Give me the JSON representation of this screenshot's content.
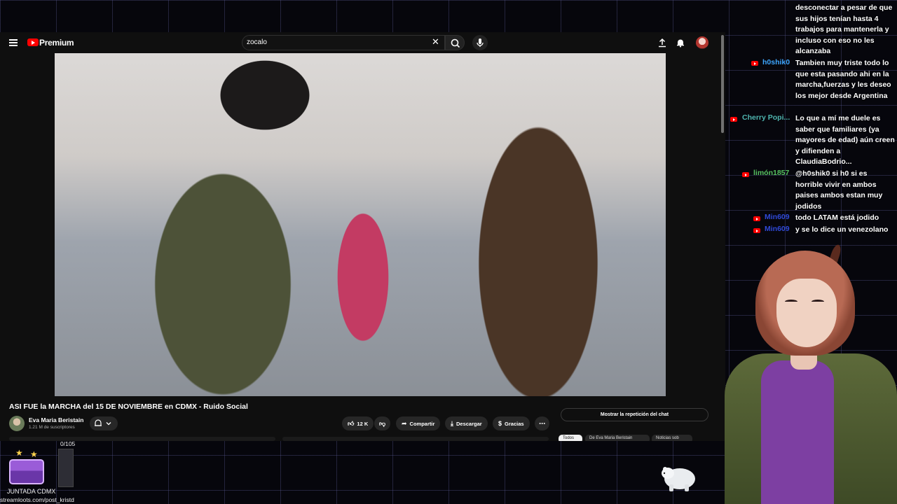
{
  "youtube": {
    "brand": "Premium",
    "search": {
      "value": "zocalo",
      "placeholder": ""
    },
    "video": {
      "title": "ASI FUE la MARCHA del 15 DE NOVIEMBRE en CDMX - Ruido Social",
      "channel_name": "Eva Maria Beristain",
      "subscribers": "1.21 M de suscriptores",
      "likes": "12 K",
      "share_label": "Compartir",
      "download_label": "Descargar",
      "thanks_label": "Gracias"
    },
    "chat_replay_label": "Mostrar la repetición del chat",
    "chips": [
      {
        "label": "Todos"
      },
      {
        "label": "De Eva Maria Beristain"
      },
      {
        "label": "Noticias sob"
      }
    ]
  },
  "chat": {
    "messages": [
      {
        "user": "",
        "user_color": "#ffffff",
        "text": "desconectar a pesar de que sus hijos tenían hasta 4 trabajos para mantenerla y incluso con eso no les alcanzaba"
      },
      {
        "user": "h0shik0",
        "user_color": "#3ea6ff",
        "text": "Tambien muy triste todo lo que esta pasando ahi en la marcha,fuerzas y les deseo los mejor desde Argentina"
      },
      {
        "user": "Cherry Popi...",
        "user_color": "#4fb6b0",
        "text": "Lo que a mí me duele es saber que familiares (ya mayores de edad) aún creen y difienden a ClaudiaBodrio..."
      },
      {
        "user": "limón1857",
        "user_color": "#56c060",
        "text": "@h0shik0 si h0 si es horrible vivir en ambos paises ambos estan muy jodidos"
      },
      {
        "user": "Min609",
        "user_color": "#2f49d8",
        "text": "todo LATAM está jodido"
      },
      {
        "user": "Min609",
        "user_color": "#2f49d8",
        "text": "y se lo dice un venezolano"
      }
    ]
  },
  "widget": {
    "goal_count": "0/105",
    "goal_progress": 0,
    "goal_label": "JUNTADA CDMX",
    "streamloots_url": "streamloots.com/post_kristd"
  },
  "colors": {
    "youtube_red": "#ff0000",
    "yt_background": "#0f0f0f",
    "grid_line": "#5a5a96"
  }
}
